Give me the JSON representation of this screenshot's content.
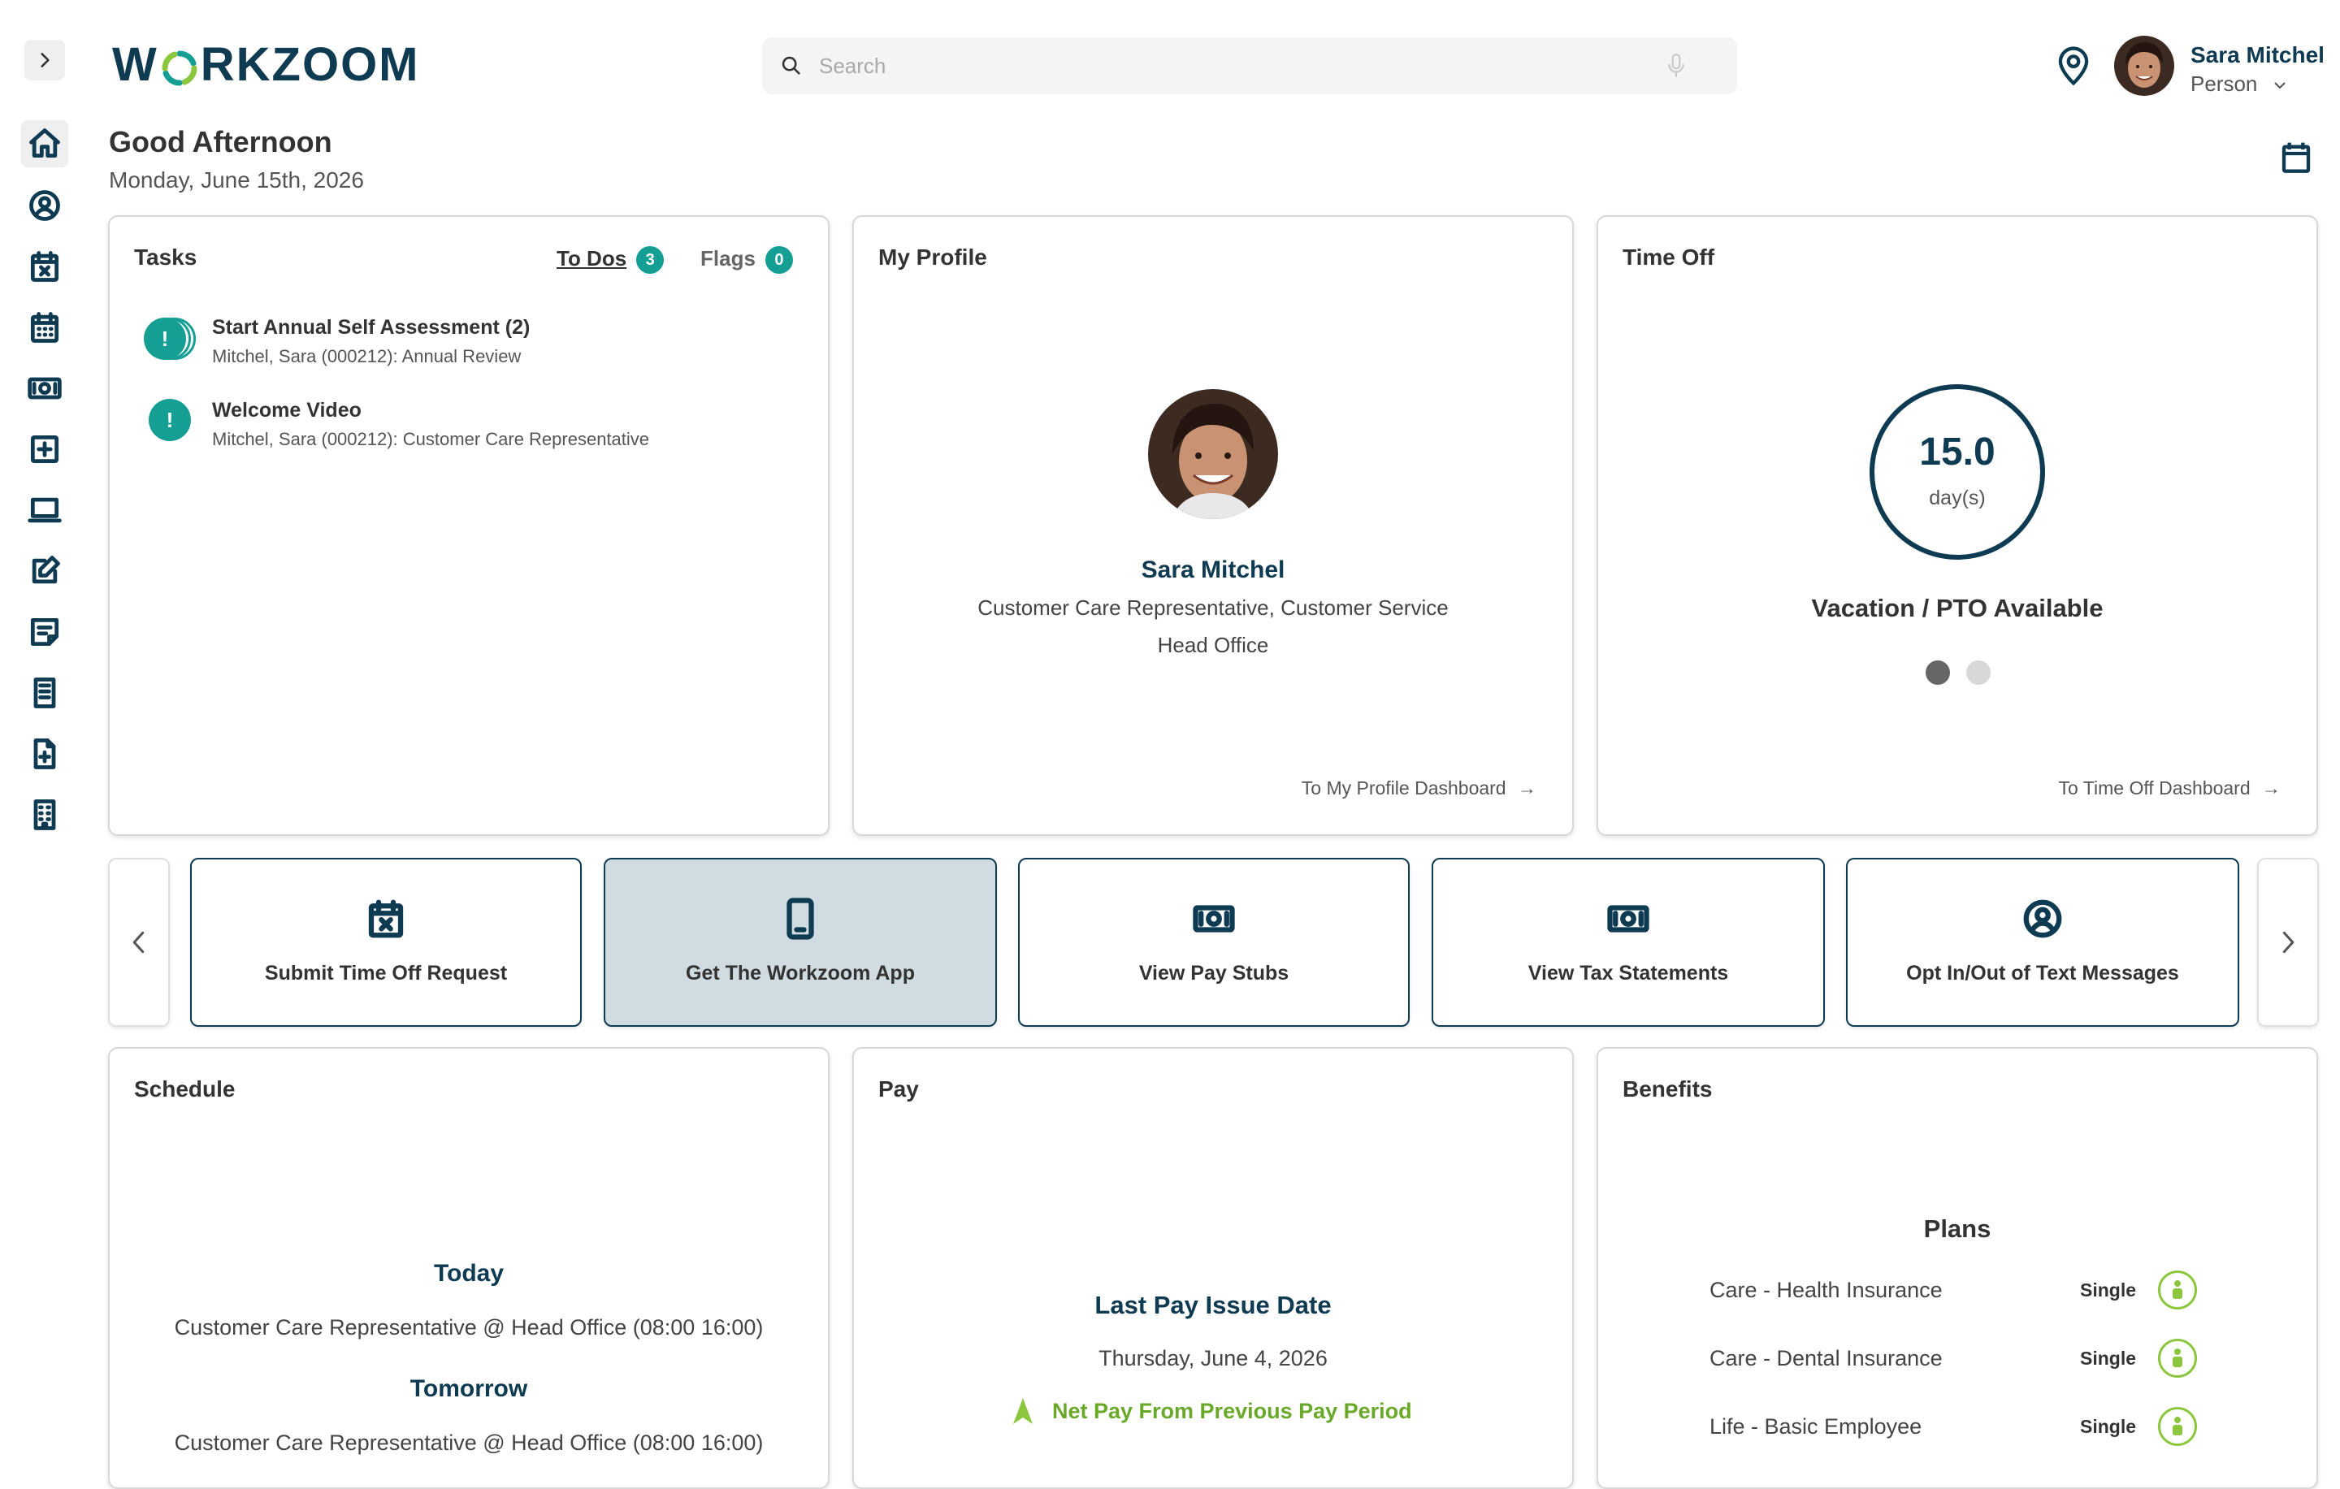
{
  "brand": {
    "logo_text": "WORKZOOM",
    "logo_prefix": "W",
    "logo_suffix": "RKZOOM"
  },
  "search": {
    "placeholder": "Search"
  },
  "user": {
    "name": "Sara Mitchel",
    "role": "Person"
  },
  "greeting": {
    "title": "Good Afternoon",
    "date": "Monday, June 15th, 2026"
  },
  "sidebar": {
    "items": [
      {
        "icon": "home-icon"
      },
      {
        "icon": "user-circle-icon"
      },
      {
        "icon": "calendar-x-icon"
      },
      {
        "icon": "calendar-grid-icon"
      },
      {
        "icon": "money-icon"
      },
      {
        "icon": "plus-square-icon"
      },
      {
        "icon": "laptop-icon"
      },
      {
        "icon": "edit-icon"
      },
      {
        "icon": "note-icon"
      },
      {
        "icon": "list-icon"
      },
      {
        "icon": "file-plus-icon"
      },
      {
        "icon": "building-icon"
      }
    ]
  },
  "tasks": {
    "title": "Tasks",
    "todos_label": "To Dos",
    "todos_count": "3",
    "flags_label": "Flags",
    "flags_count": "0",
    "items": [
      {
        "title": "Start Annual Self Assessment (2)",
        "subtitle": "Mitchel, Sara (000212): Annual Review"
      },
      {
        "title": "Welcome Video",
        "subtitle": "Mitchel, Sara (000212): Customer Care Representative"
      }
    ],
    "alert_glyph": "!"
  },
  "profile": {
    "title": "My Profile",
    "name": "Sara Mitchel",
    "position": "Customer Care Representative, Customer Service",
    "location": "Head Office",
    "link": "To My Profile Dashboard"
  },
  "time_off": {
    "title": "Time Off",
    "value": "15.0",
    "unit": "day(s)",
    "label": "Vacation / PTO Available",
    "link": "To Time Off Dashboard"
  },
  "quick_links": [
    {
      "label": "Submit Time Off Request",
      "icon": "calendar-x-icon"
    },
    {
      "label": "Get The Workzoom App",
      "icon": "phone-icon"
    },
    {
      "label": "View Pay Stubs",
      "icon": "money-icon"
    },
    {
      "label": "View Tax Statements",
      "icon": "money-icon"
    },
    {
      "label": "Opt In/Out of Text Messages",
      "icon": "user-circle-icon"
    }
  ],
  "schedule": {
    "title": "Schedule",
    "today_label": "Today",
    "today_shift": "Customer Care Representative @ Head Office (08:00 16:00)",
    "tomorrow_label": "Tomorrow",
    "tomorrow_shift": "Customer Care Representative @ Head Office (08:00 16:00)"
  },
  "pay": {
    "title": "Pay",
    "heading": "Last Pay Issue Date",
    "date": "Thursday, June 4, 2026",
    "net_pay_label": "Net Pay From Previous Pay Period"
  },
  "benefits": {
    "title": "Benefits",
    "heading": "Plans",
    "plans": [
      {
        "name": "Care - Health Insurance",
        "type": "Single"
      },
      {
        "name": "Care - Dental Insurance",
        "type": "Single"
      },
      {
        "name": "Life - Basic Employee",
        "type": "Single"
      }
    ]
  },
  "colors": {
    "navy": "#0e3a52",
    "teal": "#149e94",
    "green": "#8cc63f",
    "link_active_bg": "#d1dbe2"
  }
}
